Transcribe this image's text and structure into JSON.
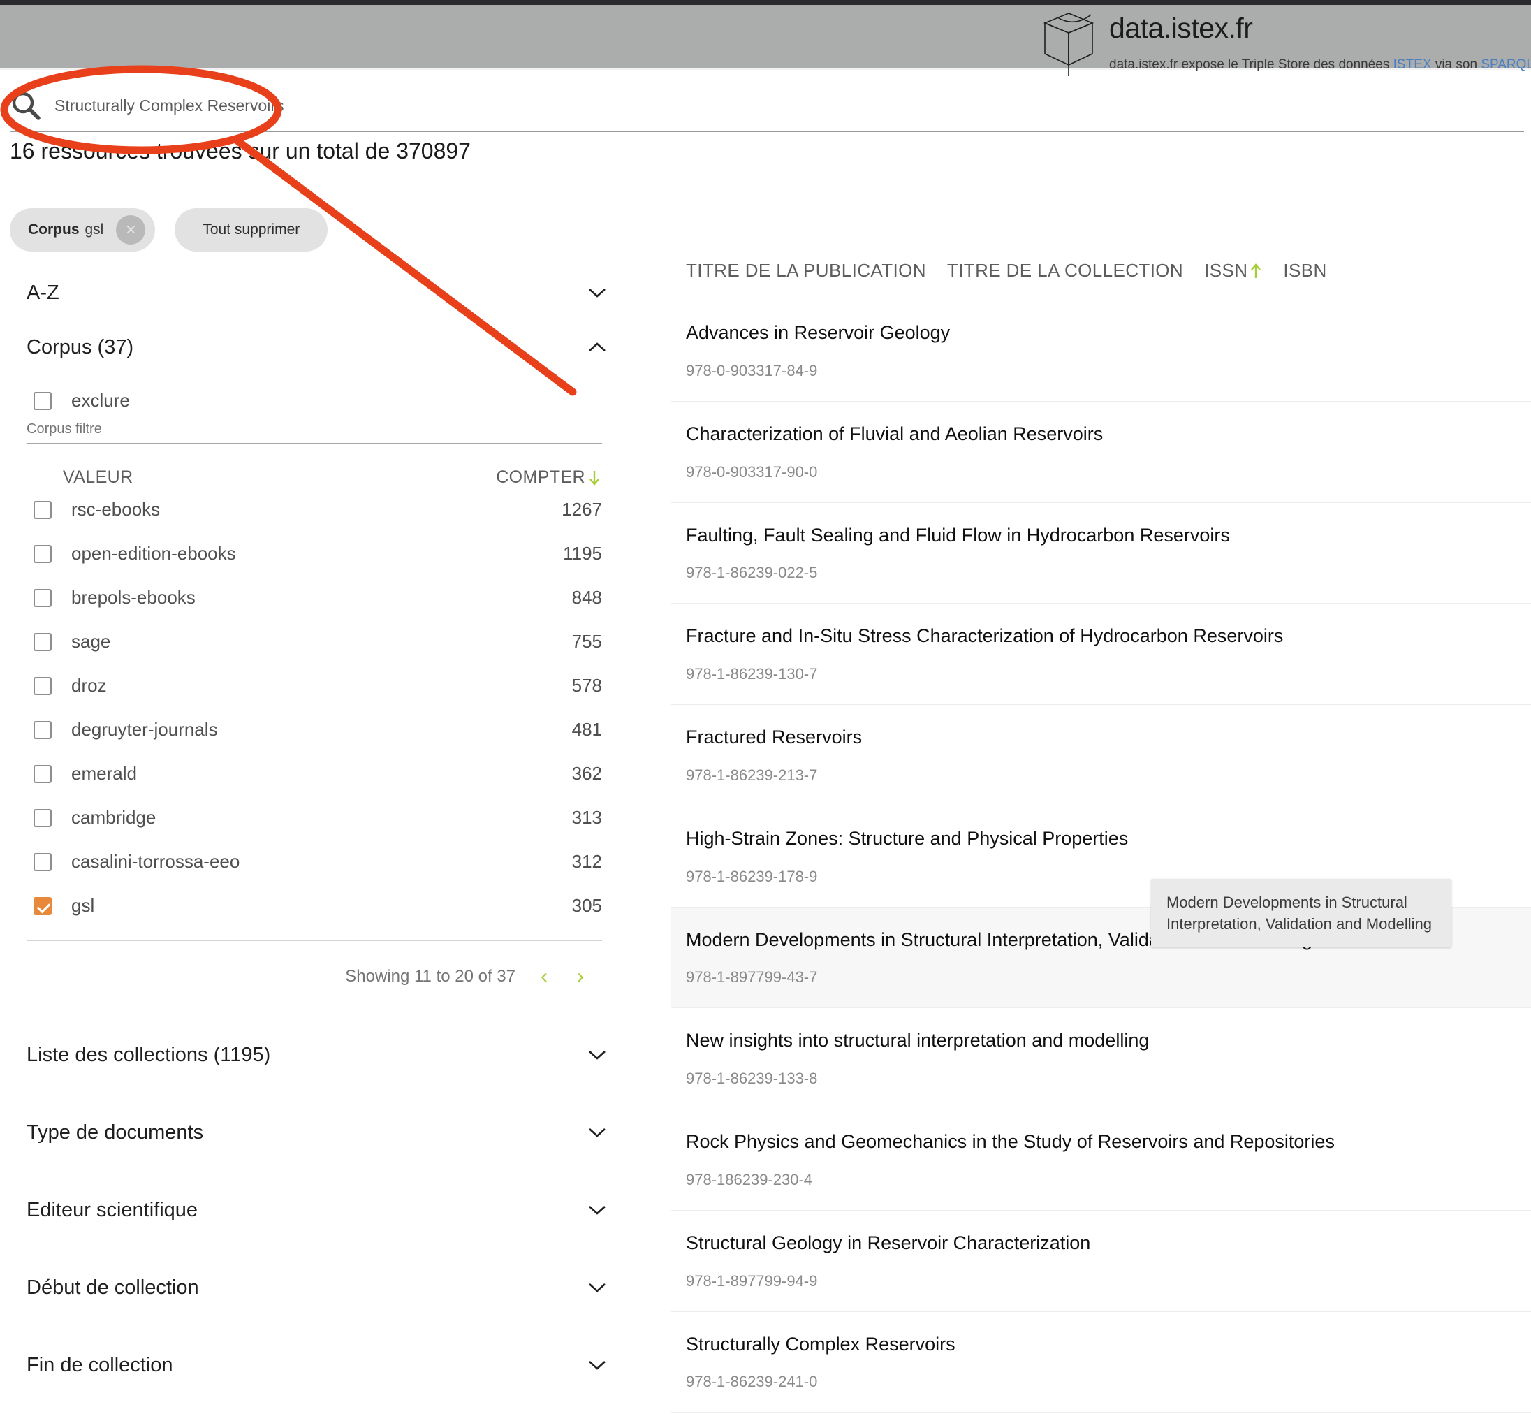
{
  "header": {
    "brand_title": "data.istex.fr",
    "brand_subtitle_pre": "data.istex.fr expose le Triple Store des données ",
    "brand_link_1": "ISTEX",
    "brand_subtitle_mid": " via son ",
    "brand_link_2": "SPARQL E"
  },
  "search": {
    "value": "Structurally Complex Reservoirs",
    "icon": "search-icon"
  },
  "result_count_text": "16 ressources trouvées sur un total de 370897",
  "chips": {
    "corpus_key": "Corpus",
    "corpus_value": "gsl",
    "remove_icon": "×",
    "clear_all_label": "Tout supprimer"
  },
  "facets": {
    "az": {
      "label": "A-Z",
      "expanded": false
    },
    "corpus": {
      "label": "Corpus (37)",
      "expanded": true,
      "exclude_label": "exclure",
      "filter_placeholder": "Corpus filtre",
      "col_value": "VALEUR",
      "col_count": "COMPTER",
      "count_sort_direction": "desc",
      "rows": [
        {
          "label": "rsc-ebooks",
          "count": "1267",
          "checked": false
        },
        {
          "label": "open-edition-ebooks",
          "count": "1195",
          "checked": false
        },
        {
          "label": "brepols-ebooks",
          "count": "848",
          "checked": false
        },
        {
          "label": "sage",
          "count": "755",
          "checked": false
        },
        {
          "label": "droz",
          "count": "578",
          "checked": false
        },
        {
          "label": "degruyter-journals",
          "count": "481",
          "checked": false
        },
        {
          "label": "emerald",
          "count": "362",
          "checked": false
        },
        {
          "label": "cambridge",
          "count": "313",
          "checked": false
        },
        {
          "label": "casalini-torrossa-eeo",
          "count": "312",
          "checked": false
        },
        {
          "label": "gsl",
          "count": "305",
          "checked": true
        }
      ],
      "pager_text": "Showing 11 to 20 of 37",
      "pager_prev": "‹",
      "pager_next": "›"
    },
    "others": [
      {
        "label": "Liste des collections (1195)"
      },
      {
        "label": "Type de documents"
      },
      {
        "label": "Editeur scientifique"
      },
      {
        "label": "Début de collection"
      },
      {
        "label": "Fin de collection"
      }
    ]
  },
  "results": {
    "columns": [
      {
        "label": "TITRE DE LA PUBLICATION",
        "sorted": false
      },
      {
        "label": "TITRE DE LA COLLECTION",
        "sorted": false
      },
      {
        "label": "ISSN",
        "sorted": true,
        "sort_direction": "asc"
      },
      {
        "label": "ISBN",
        "sorted": false
      }
    ],
    "rows": [
      {
        "title": "Advances in Reservoir Geology",
        "isbn": "978-0-903317-84-9",
        "active": false
      },
      {
        "title": "Characterization of Fluvial and Aeolian Reservoirs",
        "isbn": "978-0-903317-90-0",
        "active": false
      },
      {
        "title": "Faulting, Fault Sealing and Fluid Flow in Hydrocarbon Reservoirs",
        "isbn": "978-1-86239-022-5",
        "active": false
      },
      {
        "title": "Fracture and In-Situ Stress Characterization of Hydrocarbon Reservoirs",
        "isbn": "978-1-86239-130-7",
        "active": false
      },
      {
        "title": "Fractured Reservoirs",
        "isbn": "978-1-86239-213-7",
        "active": false
      },
      {
        "title": "High-Strain Zones: Structure and Physical Properties",
        "isbn": "978-1-86239-178-9",
        "active": false
      },
      {
        "title": "Modern Developments in Structural Interpretation, Validation and Modelling",
        "isbn": "978-1-897799-43-7",
        "active": true
      },
      {
        "title": "New insights into structural interpretation and modelling",
        "isbn": "978-1-86239-133-8",
        "active": false
      },
      {
        "title": "Rock Physics and Geomechanics in the Study of Reservoirs and Repositories",
        "isbn": "978-186239-230-4",
        "active": false
      },
      {
        "title": "Structural Geology in Reservoir Characterization",
        "isbn": "978-1-897799-94-9",
        "active": false
      },
      {
        "title": "Structurally Complex Reservoirs",
        "isbn": "978-1-86239-241-0",
        "active": false
      }
    ]
  },
  "tooltip": {
    "text": "Modern Developments in Structural Interpretation, Validation and Modelling"
  },
  "annotation": {
    "color": "#E8401A",
    "shape": "ellipse-with-pointer-line"
  },
  "colors": {
    "accent_orange": "#E8883A",
    "accent_green": "#A6CE39",
    "header_gray": "#ABADAD",
    "link_blue": "#4A7FC1",
    "annotation_red": "#E8401A"
  }
}
